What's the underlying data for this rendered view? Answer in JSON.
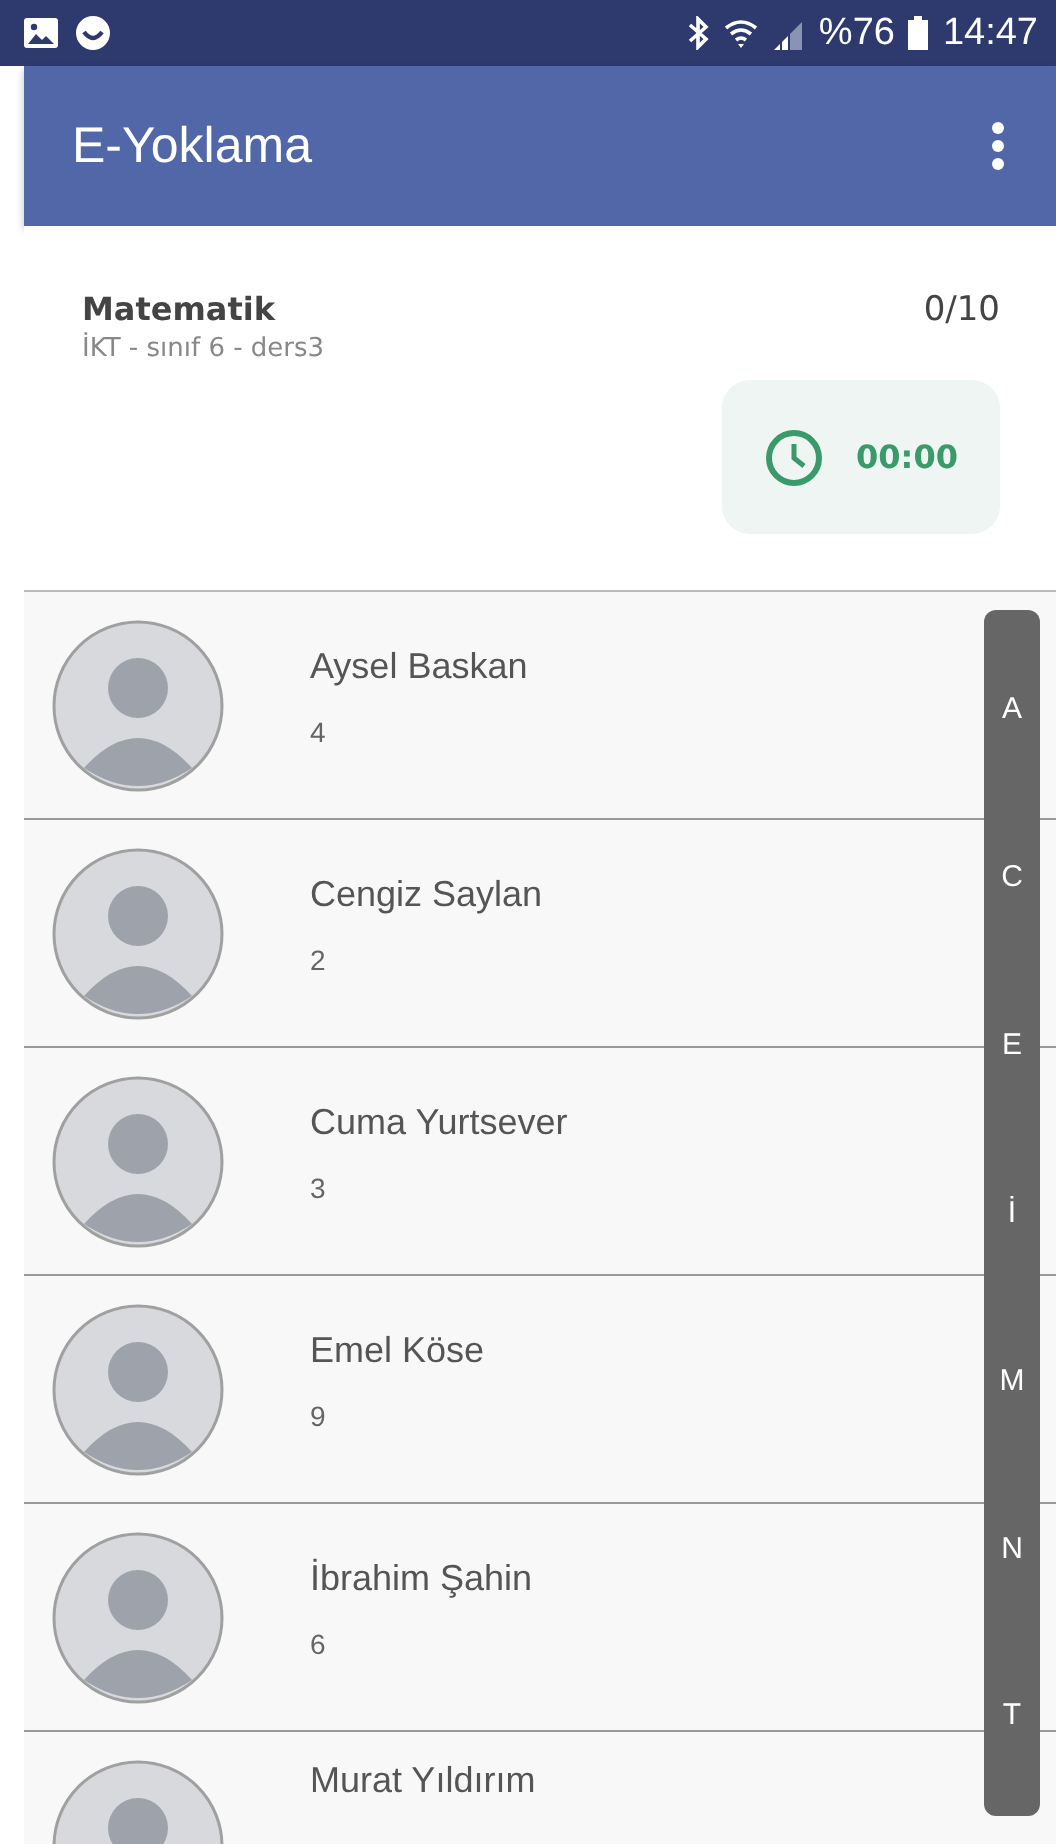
{
  "status_bar": {
    "battery_percent": "%76",
    "time": "14:47"
  },
  "app_bar": {
    "title": "E-Yoklama"
  },
  "lesson": {
    "name": "Matematik",
    "details": "İKT - sınıf 6 - ders3",
    "count": "0/10",
    "timer": "00:00"
  },
  "students": [
    {
      "name": "Aysel Baskan",
      "number": "4"
    },
    {
      "name": "Cengiz Saylan",
      "number": "2"
    },
    {
      "name": "Cuma Yurtsever",
      "number": "3"
    },
    {
      "name": "Emel Köse",
      "number": "9"
    },
    {
      "name": "İbrahim Şahin",
      "number": "6"
    },
    {
      "name": "Murat Yıldırım"
    }
  ],
  "index_letters": [
    "A",
    "C",
    "E",
    "İ",
    "M",
    "N",
    "T"
  ]
}
